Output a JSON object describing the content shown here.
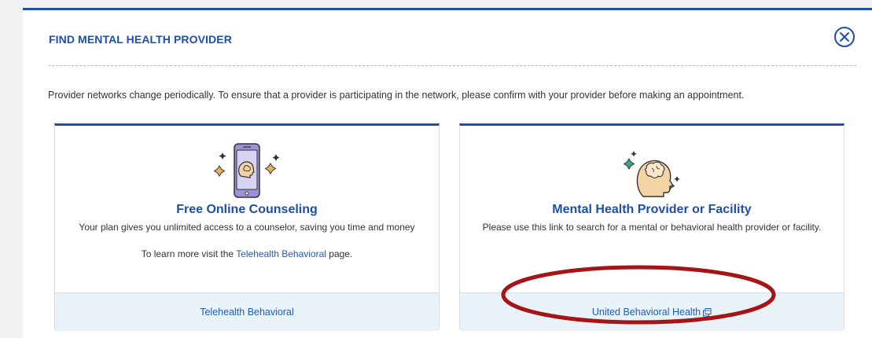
{
  "modal": {
    "title": "FIND MENTAL HEALTH PROVIDER",
    "notice": "Provider networks change periodically. To ensure that a provider is participating in the network, please confirm with your provider before making an appointment."
  },
  "cards": [
    {
      "title": "Free Online Counseling",
      "description": "Your plan gives you unlimited access to a counselor, saving you time and money",
      "more_prefix": "To learn more visit the ",
      "more_link": "Telehealth Behavioral",
      "more_suffix": " page.",
      "footer_link": "Telehealth Behavioral",
      "icon": "phone-brain-icon"
    },
    {
      "title": "Mental Health Provider or Facility",
      "description": "Please use this link to search for a mental or behavioral health provider or facility.",
      "footer_link": "United Behavioral Health",
      "icon": "head-brain-icon"
    }
  ],
  "colors": {
    "brand_blue": "#1f4faa",
    "footer_bg": "#e9f3f7",
    "highlight_red": "#a51417",
    "icon_fill": "#f4d3a4",
    "phone_purple": "#9b92d8"
  }
}
